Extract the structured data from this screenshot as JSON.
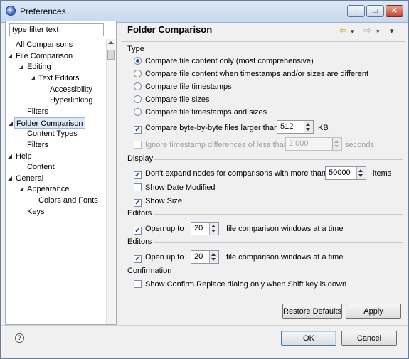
{
  "window": {
    "title": "Preferences",
    "minimize": "–",
    "maximize": "□",
    "close": "✕"
  },
  "filter": {
    "placeholder": "type filter text",
    "value": "type filter text"
  },
  "tree": [
    {
      "label": "All Comparisons",
      "expanded": null,
      "selected": false
    },
    {
      "label": "File Comparison",
      "expanded": true,
      "selected": false
    },
    {
      "label": "Editing",
      "expanded": true,
      "selected": false
    },
    {
      "label": "Text Editors",
      "expanded": true,
      "selected": false
    },
    {
      "label": "Accessibility",
      "expanded": null,
      "selected": false
    },
    {
      "label": "Hyperlinking",
      "expanded": null,
      "selected": false
    },
    {
      "label": "Filters",
      "expanded": null,
      "selected": false
    },
    {
      "label": "Folder Comparison",
      "expanded": true,
      "selected": true
    },
    {
      "label": "Content Types",
      "expanded": null,
      "selected": false
    },
    {
      "label": "Filters",
      "expanded": null,
      "selected": false
    },
    {
      "label": "Help",
      "expanded": true,
      "selected": false
    },
    {
      "label": "Content",
      "expanded": null,
      "selected": false
    },
    {
      "label": "General",
      "expanded": true,
      "selected": false
    },
    {
      "label": "Appearance",
      "expanded": true,
      "selected": false
    },
    {
      "label": "Colors and Fonts",
      "expanded": null,
      "selected": false
    },
    {
      "label": "Keys",
      "expanded": null,
      "selected": false
    }
  ],
  "page": {
    "title": "Folder Comparison",
    "nav_back": "⇦",
    "nav_forward": "⇨",
    "dropdown": "▾"
  },
  "type_group": {
    "label": "Type",
    "options": [
      {
        "label": "Compare file content only (most comprehensive)",
        "checked": true
      },
      {
        "label": "Compare file content when timestamps and/or sizes are different",
        "checked": false
      },
      {
        "label": "Compare file timestamps",
        "checked": false
      },
      {
        "label": "Compare file sizes",
        "checked": false
      },
      {
        "label": "Compare file timestamps and sizes",
        "checked": false
      }
    ],
    "byte_compare": {
      "label": "Compare byte-by-byte files larger than",
      "checked": true,
      "value": "512",
      "unit": "KB"
    },
    "ignore_timestamp": {
      "label": "Ignore timestamp differences of less than",
      "checked": false,
      "enabled": false,
      "value": "2,000",
      "unit": "seconds"
    }
  },
  "display_group": {
    "label": "Display",
    "expand": {
      "label": "Don't expand nodes for comparisons with more than",
      "checked": true,
      "value": "50000",
      "unit": "items"
    },
    "date_modified": {
      "label": "Show Date Modified",
      "checked": false
    },
    "size": {
      "label": "Show Size",
      "checked": true
    }
  },
  "editors_group_1": {
    "label": "Editors",
    "open_label": "Open up to",
    "checked": true,
    "value": "20",
    "suffix": "file comparison windows at a time"
  },
  "editors_group_2": {
    "label": "Editors",
    "open_label": "Open up to",
    "checked": true,
    "value": "20",
    "suffix": "file comparison windows at a time"
  },
  "confirmation_group": {
    "label": "Confirmation",
    "option": {
      "label": "Show Confirm Replace dialog only when Shift key is down",
      "checked": false
    }
  },
  "buttons": {
    "restore_defaults": "Restore Defaults",
    "apply": "Apply",
    "ok": "OK",
    "cancel": "Cancel",
    "help": "?"
  }
}
